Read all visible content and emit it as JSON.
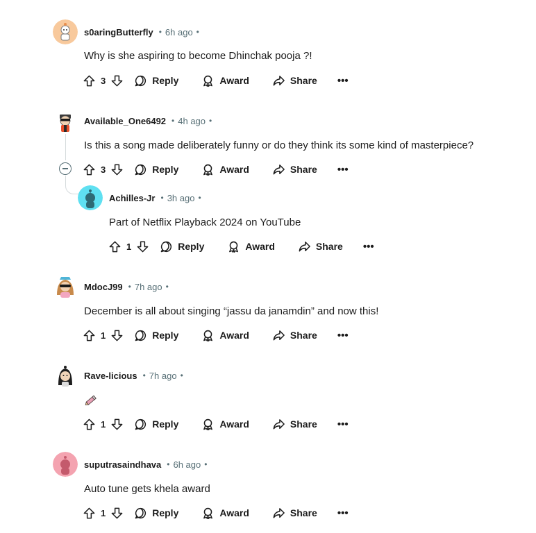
{
  "comments": [
    {
      "author": "s0aringButterfly",
      "time": "6h ago",
      "text": "Why is she aspiring to become Dhinchak pooja ?!",
      "votes": "3",
      "reply": "Reply",
      "award": "Award",
      "share": "Share",
      "more": "•••",
      "avatar_color": "#f5c9a0"
    },
    {
      "author": "Available_One6492",
      "time": "4h ago",
      "text": "Is this a song made deliberately funny or do they think its some kind of masterpiece?",
      "votes": "3",
      "reply": "Reply",
      "award": "Award",
      "share": "Share",
      "more": "•••",
      "avatar_color": "#ffffff"
    },
    {
      "author": "Achilles-Jr",
      "time": "3h ago",
      "text": "Part of Netflix Playback 2024 on YouTube",
      "votes": "1",
      "reply": "Reply",
      "award": "Award",
      "share": "Share",
      "more": "•••",
      "avatar_color": "#5ee1f2"
    },
    {
      "author": "MdocJ99",
      "time": "7h ago",
      "text": "December is all about singing “jassu da janamdin” and now this!",
      "votes": "1",
      "reply": "Reply",
      "award": "Award",
      "share": "Share",
      "more": "•••",
      "avatar_color": "#ffffff"
    },
    {
      "author": "Rave-licious",
      "time": "7h ago",
      "text": "",
      "emoji": "pencil-emoji",
      "votes": "1",
      "reply": "Reply",
      "award": "Award",
      "share": "Share",
      "more": "•••",
      "avatar_color": "#ffffff"
    },
    {
      "author": "suputrasaindhava",
      "time": "6h ago",
      "text": "Auto tune gets khela award",
      "votes": "1",
      "reply": "Reply",
      "award": "Award",
      "share": "Share",
      "more": "•••",
      "avatar_color": "#f4a3b0"
    }
  ],
  "separator": "•",
  "colors": {
    "text": "#1c1c1c",
    "meta": "#576f76",
    "thread_line": "#d5dbdd"
  },
  "icons": {
    "upvote": "upvote-icon",
    "downvote": "downvote-icon",
    "reply": "comment-bubble-icon",
    "award": "award-icon",
    "share": "share-icon",
    "collapse": "collapse-minus-icon"
  }
}
